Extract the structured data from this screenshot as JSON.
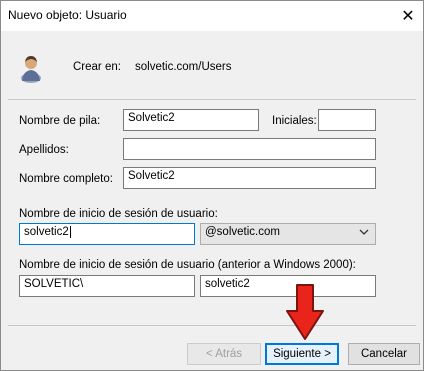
{
  "window": {
    "title": "Nuevo objeto: Usuario",
    "close_glyph": "✕"
  },
  "header": {
    "create_in_label": "Crear en:",
    "create_in_value": "solvetic.com/Users",
    "icon": "user-icon"
  },
  "form": {
    "first_name_label": "Nombre de pila:",
    "first_name_value": "Solvetic2",
    "initials_label": "Iniciales:",
    "initials_value": "",
    "last_name_label": "Apellidos:",
    "last_name_value": "",
    "full_name_label": "Nombre completo:",
    "full_name_value": "Solvetic2",
    "logon_label": "Nombre de inicio de sesión de usuario:",
    "logon_value": "solvetic2",
    "domain_value": "@solvetic.com",
    "pre2000_label": "Nombre de inicio de sesión de usuario (anterior a Windows 2000):",
    "pre2000_domain_value": "SOLVETIC\\",
    "pre2000_user_value": "solvetic2"
  },
  "buttons": {
    "back": "< Atrás",
    "next": "Siguiente >",
    "cancel": "Cancelar"
  },
  "annotation": {
    "icon": "red-down-arrow-icon",
    "color": "#e8241b"
  }
}
